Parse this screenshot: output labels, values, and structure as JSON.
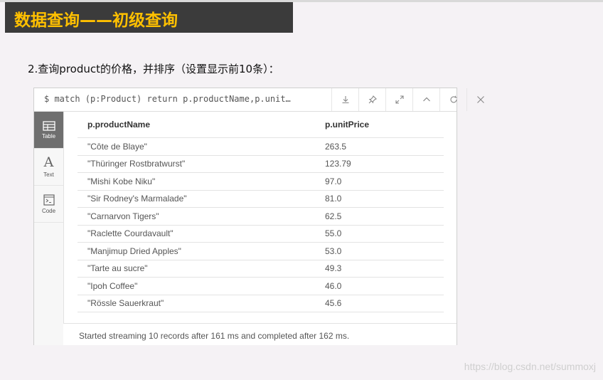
{
  "slide": {
    "title": "数据查询——初级查询",
    "subtitle": "2.查询product的价格，并排序（设置显示前10条）："
  },
  "frame": {
    "command": "$ match (p:Product) return p.productName,p.unit…",
    "toolbar_icons": [
      "download-icon",
      "pin-icon",
      "expand-icon",
      "collapse-up-icon",
      "rerun-icon",
      "close-icon"
    ],
    "sidebar": [
      {
        "label": "Table",
        "icon": "table-icon",
        "active": true
      },
      {
        "label": "Text",
        "icon": "text-icon",
        "active": false
      },
      {
        "label": "Code",
        "icon": "code-icon",
        "active": false
      }
    ],
    "table": {
      "columns": [
        "p.productName",
        "p.unitPrice"
      ],
      "rows": [
        [
          "\"Côte de Blaye\"",
          "263.5"
        ],
        [
          "\"Thüringer Rostbratwurst\"",
          "123.79"
        ],
        [
          "\"Mishi Kobe Niku\"",
          "97.0"
        ],
        [
          "\"Sir Rodney's Marmalade\"",
          "81.0"
        ],
        [
          "\"Carnarvon Tigers\"",
          "62.5"
        ],
        [
          "\"Raclette Courdavault\"",
          "55.0"
        ],
        [
          "\"Manjimup Dried Apples\"",
          "53.0"
        ],
        [
          "\"Tarte au sucre\"",
          "49.3"
        ],
        [
          "\"Ipoh Coffee\"",
          "46.0"
        ],
        [
          "\"Rössle Sauerkraut\"",
          "45.6"
        ]
      ]
    },
    "status": "Started streaming 10 records after 161 ms and completed after 162 ms."
  },
  "watermark": "https://blog.csdn.net/summoxj",
  "colors": {
    "banner_bg": "#3b3b3b",
    "banner_text": "#ffc000",
    "active_tab": "#6f6f6f"
  }
}
